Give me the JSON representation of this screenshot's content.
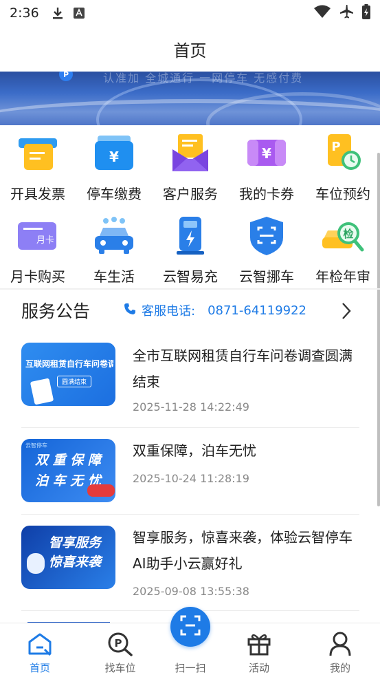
{
  "status_bar": {
    "time": "2:36"
  },
  "header": {
    "title": "首页"
  },
  "banner": {
    "faded_text": "认准加 全城通行 一网停车 无感付费"
  },
  "services": [
    {
      "label": "开具发票",
      "icon": "invoice-icon"
    },
    {
      "label": "停车缴费",
      "icon": "parking-payment-icon"
    },
    {
      "label": "客户服务",
      "icon": "customer-service-icon"
    },
    {
      "label": "我的卡券",
      "icon": "coupon-icon"
    },
    {
      "label": "车位预约",
      "icon": "parking-reservation-icon"
    },
    {
      "label": "月卡购买",
      "icon": "monthly-card-icon"
    },
    {
      "label": "车生活",
      "icon": "car-life-icon"
    },
    {
      "label": "云智易充",
      "icon": "charging-icon"
    },
    {
      "label": "云智挪车",
      "icon": "move-car-icon"
    },
    {
      "label": "年检年审",
      "icon": "annual-inspection-icon"
    }
  ],
  "notice": {
    "title": "服务公告",
    "phone_label": "客服电话:",
    "phone_number": "0871-64119922"
  },
  "news": [
    {
      "title": "全市互联网租赁自行车问卷调查圆满结束",
      "date": "2025-11-28 14:22:49",
      "thumb_text": "互联网租赁自行车问卷调查",
      "thumb_badge": "圆满结束"
    },
    {
      "title": "双重保障，泊车无忧",
      "date": "2025-10-24 11:28:19",
      "thumb_line1": "双 重 保 障",
      "thumb_line2": "泊 车 无 忧",
      "thumb_tag": "云智停车"
    },
    {
      "title": "智享服务，惊喜来袭，体验云智停车AI助手小云赢好礼",
      "date": "2025-09-08 13:55:38",
      "thumb_line1": "智享服务",
      "thumb_line2": "惊喜来袭"
    }
  ],
  "tabbar": [
    {
      "label": "首页",
      "icon": "home-icon",
      "active": true
    },
    {
      "label": "找车位",
      "icon": "find-parking-icon",
      "active": false
    },
    {
      "label": "扫一扫",
      "icon": "scan-icon",
      "active": false
    },
    {
      "label": "活动",
      "icon": "gift-icon",
      "active": false
    },
    {
      "label": "我的",
      "icon": "user-icon",
      "active": false
    }
  ],
  "colors": {
    "accent": "#1e7be6",
    "text": "#222222",
    "muted": "#888888"
  }
}
